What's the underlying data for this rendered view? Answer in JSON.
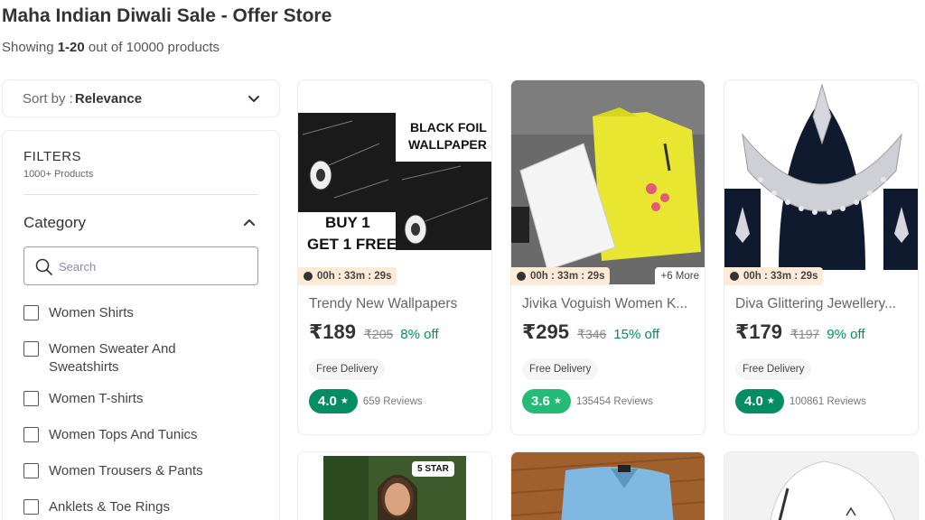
{
  "header": {
    "title": "Maha Indian Diwali Sale - Offer Store",
    "showing_prefix": "Showing ",
    "showing_range": "1-20",
    "showing_suffix": " out of 10000 products"
  },
  "sort": {
    "label": "Sort by :",
    "value": "Relevance",
    "icon": "chevron-down-icon"
  },
  "filters": {
    "title": "FILTERS",
    "count": "1000+ Products",
    "category": {
      "title": "Category",
      "search_placeholder": "Search",
      "items": [
        {
          "label": "Women Shirts"
        },
        {
          "label": "Women Sweater And",
          "label2": "Sweatshirts"
        },
        {
          "label": "Women T-shirts"
        },
        {
          "label": "Women Tops And Tunics"
        },
        {
          "label": "Women Trousers & Pants"
        },
        {
          "label": "Anklets & Toe Rings"
        }
      ]
    }
  },
  "products": [
    {
      "name": "Trendy New Wallpapers",
      "price": "₹189",
      "mrp": "₹205",
      "discount": "8% off",
      "delivery": "Free Delivery",
      "rating": "4.0",
      "rating_color": "#038d63",
      "reviews": "659 Reviews",
      "timer": "00h : 33m : 29s",
      "image_text": {
        "line1": "BLACK FOIL",
        "line2": "WALLPAPER",
        "line3": "BUY 1",
        "line4": "GET 1 FREE"
      }
    },
    {
      "name": "Jivika Voguish Women K...",
      "price": "₹295",
      "mrp": "₹346",
      "discount": "15% off",
      "delivery": "Free Delivery",
      "rating": "3.6",
      "rating_color": "#23bb75",
      "reviews": "135454 Reviews",
      "timer": "00h : 33m : 29s",
      "more": "+6 More"
    },
    {
      "name": "Diva Glittering Jewellery...",
      "price": "₹179",
      "mrp": "₹197",
      "discount": "9% off",
      "delivery": "Free Delivery",
      "rating": "4.0",
      "rating_color": "#038d63",
      "reviews": "100861 Reviews",
      "timer": "00h : 33m : 29s"
    }
  ],
  "row2": {
    "badge": "5 STAR"
  },
  "colors": {
    "accent_green": "#038d63",
    "light_green": "#23bb75",
    "timer_bg": "#fdebd8"
  }
}
